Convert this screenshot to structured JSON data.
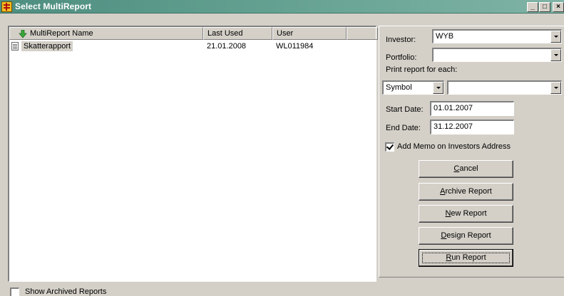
{
  "window": {
    "title": "Select MultiReport",
    "controls": {
      "minimize": "_",
      "maximize": "□",
      "close": "×"
    }
  },
  "list": {
    "columns": [
      "MultiReport Name",
      "Last Used",
      "User"
    ],
    "rows": [
      {
        "name": "Skatterapport",
        "last_used": "21.01.2008",
        "user": "WL011984"
      }
    ]
  },
  "form": {
    "investor_label": "Investor:",
    "investor_value": "WYB",
    "portfolio_label": "Portfolio:",
    "portfolio_value": "",
    "print_each_label": "Print report for each:",
    "print_each_value": "Symbol",
    "print_each_second_value": "",
    "start_date_label": "Start Date:",
    "start_date_value": "01.01.2007",
    "end_date_label": "End Date:",
    "end_date_value": "31.12.2007",
    "add_memo_label": "Add Memo on Investors Address",
    "add_memo_checked": true
  },
  "buttons": {
    "cancel": {
      "accel": "C",
      "rest": "ancel"
    },
    "archive": {
      "accel": "A",
      "rest": "rchive Report"
    },
    "new": {
      "accel": "N",
      "rest": "ew Report"
    },
    "design": {
      "accel": "D",
      "rest": "esign Report"
    },
    "run": {
      "accel": "R",
      "rest": "un Report"
    }
  },
  "footer": {
    "show_archived_label": "Show Archived Reports",
    "show_archived_checked": false
  },
  "icons": [
    "app-icon",
    "green-arrow-icon",
    "document-icon",
    "chevron-down-icon",
    "check-icon"
  ],
  "colors": {
    "titlebar": "#4d8e80",
    "face": "#d4d0c8",
    "selection": "#d4d0c8"
  }
}
